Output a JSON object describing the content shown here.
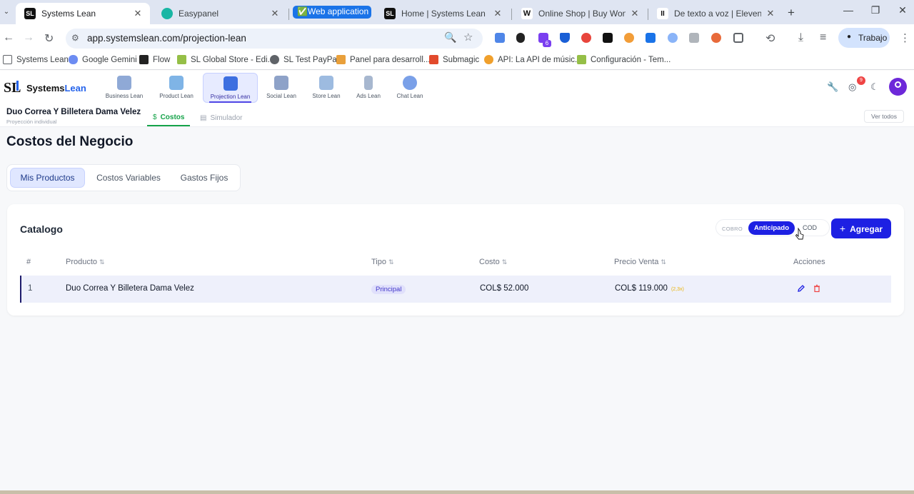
{
  "browser": {
    "tabs": [
      {
        "title": "Systems Lean",
        "active": true
      },
      {
        "title": "Easypanel",
        "active": false
      },
      {
        "title": "Web application d",
        "group": true
      },
      {
        "title": "Home | Systems Lean",
        "active": false
      },
      {
        "title": "Online Shop | Buy Wondersh",
        "active": false
      },
      {
        "title": "De texto a voz | ElevenLabs",
        "active": false
      }
    ],
    "url": "app.systemslean.com/projection-lean",
    "extension_badge": "6",
    "profile_label": "Trabajo",
    "bookmarks": [
      "Systems Lean",
      "Google Gemini",
      "Flow",
      "SL Global Store - Edi...",
      "SL Test PayPal",
      "Panel para desarroll...",
      "Submagic",
      "API: La API de músic...",
      "Configuración - Tem..."
    ]
  },
  "app": {
    "logo_text_main": "Systems",
    "logo_text_accent": "Lean",
    "modules": [
      {
        "label": "Business Lean",
        "color": "#8fa9d6"
      },
      {
        "label": "Product Lean",
        "color": "#7fb4e6"
      },
      {
        "label": "Projection Lean",
        "color": "#3d6fe0"
      },
      {
        "label": "Social Lean",
        "color": "#8ea2c8"
      },
      {
        "label": "Store Lean",
        "color": "#9dbbe0"
      },
      {
        "label": "Ads Lean",
        "color": "#a7b7cf"
      },
      {
        "label": "Chat Lean",
        "color": "#7aa0e8"
      }
    ],
    "notifications_count": "9"
  },
  "project": {
    "name": "Duo Correa Y Billetera Dama Velez",
    "subtitle": "Proyección individual",
    "tabs": [
      {
        "label": "Costos",
        "icon": "$"
      },
      {
        "label": "Simulador",
        "icon": "calculator"
      }
    ],
    "see_all": "Ver todos"
  },
  "page": {
    "title": "Costos del Negocio",
    "segments": [
      "Mis Productos",
      "Costos Variables",
      "Gastos Fijos"
    ]
  },
  "catalog": {
    "title": "Catalogo",
    "payment_label": "COBRO",
    "payment_options": [
      "Anticipado",
      "COD"
    ],
    "add_button": "Agregar",
    "columns": [
      "#",
      "Producto",
      "Tipo",
      "Costo",
      "Precio Venta",
      "Acciones"
    ],
    "rows": [
      {
        "index": "1",
        "product": "Duo Correa Y Billetera Dama Velez",
        "type": "Principal",
        "cost": "COL$ 52.000",
        "price": "COL$ 119.000",
        "markup": "(2,3x)"
      }
    ]
  },
  "colors": {
    "accent": "#1d20e3",
    "success": "#16a34a",
    "danger": "#ef4444"
  }
}
